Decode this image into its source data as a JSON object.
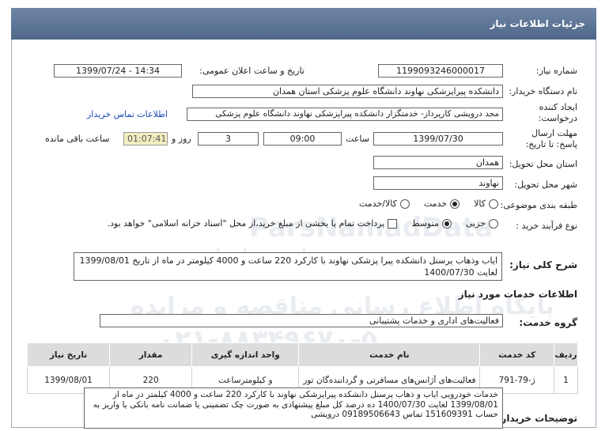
{
  "header": {
    "title": "جزئیات اطلاعات نیاز"
  },
  "fields": {
    "need_number_label": "شماره نیاز:",
    "need_number": "1199093246000017",
    "announce_label": "تاریخ و ساعت اعلان عمومی:",
    "announce_value": "1399/07/24 - 14:34",
    "buyer_label": "نام دستگاه خریدار:",
    "buyer_value": "دانشکده پیراپزشکی نهاوند دانشگاه علوم پزشکی استان همدان",
    "creator_label": "ایجاد کننده درخواست:",
    "creator_value": "مجد درویشی کارپرداز- خدمتگزار دانشکده پیراپزشکی نهاوند دانشگاه علوم پزشکی",
    "contact_link": "اطلاعات تماس خریدار",
    "deadline_label": "مهلت ارسال پاسخ: تا تاریخ:",
    "deadline_date": "1399/07/30",
    "time_label": "ساعت",
    "deadline_time": "09:00",
    "days_value": "3",
    "days_label": "روز و",
    "remaining_time": "01:07:41",
    "remaining_label": "ساعت باقی مانده",
    "province_label": "استان محل تحویل:",
    "province_value": "همدان",
    "city_label": "شهر محل تحویل:",
    "city_value": "نهاوند",
    "category_label": "طبقه بندی موضوعی:",
    "category_options": [
      "کالا",
      "خدمت",
      "کالا/خدمت"
    ],
    "purchase_label": "نوع فرآیند خرید :",
    "purchase_options": [
      "جزیی",
      "متوسط"
    ],
    "purchase_note": "پرداخت تمام یا بخشی از مبلغ خرید،از محل \"اسناد خزانه اسلامی\" خواهد بود."
  },
  "summary": {
    "label": "شرح کلی نیاز:",
    "text": "ایاب وذهاب پرسنل دانشکده پیرا پزشکی نهاوند با کارکرد 220 ساعت و 4000 کیلومتر در ماه از تاریخ 1399/08/01 لغایت 1400/07/30"
  },
  "services": {
    "section_title": "اطلاعات خدمات مورد نیاز",
    "group_label": "گروه خدمت:",
    "group_value": "فعالیت‌های اداری و خدمات پشتیبانی",
    "columns": [
      "ردیف",
      "کد خدمت",
      "نام خدمت",
      "واحد اندازه گیری",
      "مقدار",
      "تاریخ نیاز"
    ],
    "rows": [
      [
        "1",
        "ژ-79-791",
        "فعالیت‌های آژانس‌های مسافرتی و گرداننده‌گان تور",
        "و کیلومترساعت",
        "220",
        "1399/08/01"
      ]
    ]
  },
  "buyer_notes": {
    "label": "توضیحات خریدار:",
    "text": "خدمات خودرویی ایاب و ذهاب پرسنل دانشکده پیراپزشکی نهاوند با کارکرد 220 ساعت و 4000 کیلمتر در ماه از 1399/08/01 لغایت 1400/07/30 ده درصد کل مبلغ پیشنهادی به صورت چک تضمینی یا ضمانت نامه بانکی یا واریز به حساب 151609391 تماس 09189506643 درویشی"
  },
  "watermarks": [
    "ParsNamadData",
    "پارس نماد داده",
    "پایگاه اطلاع رسانی مناقصه و مزایده",
    "۰۲۱-۸۸۳۴۹۶۷۰-۵"
  ]
}
